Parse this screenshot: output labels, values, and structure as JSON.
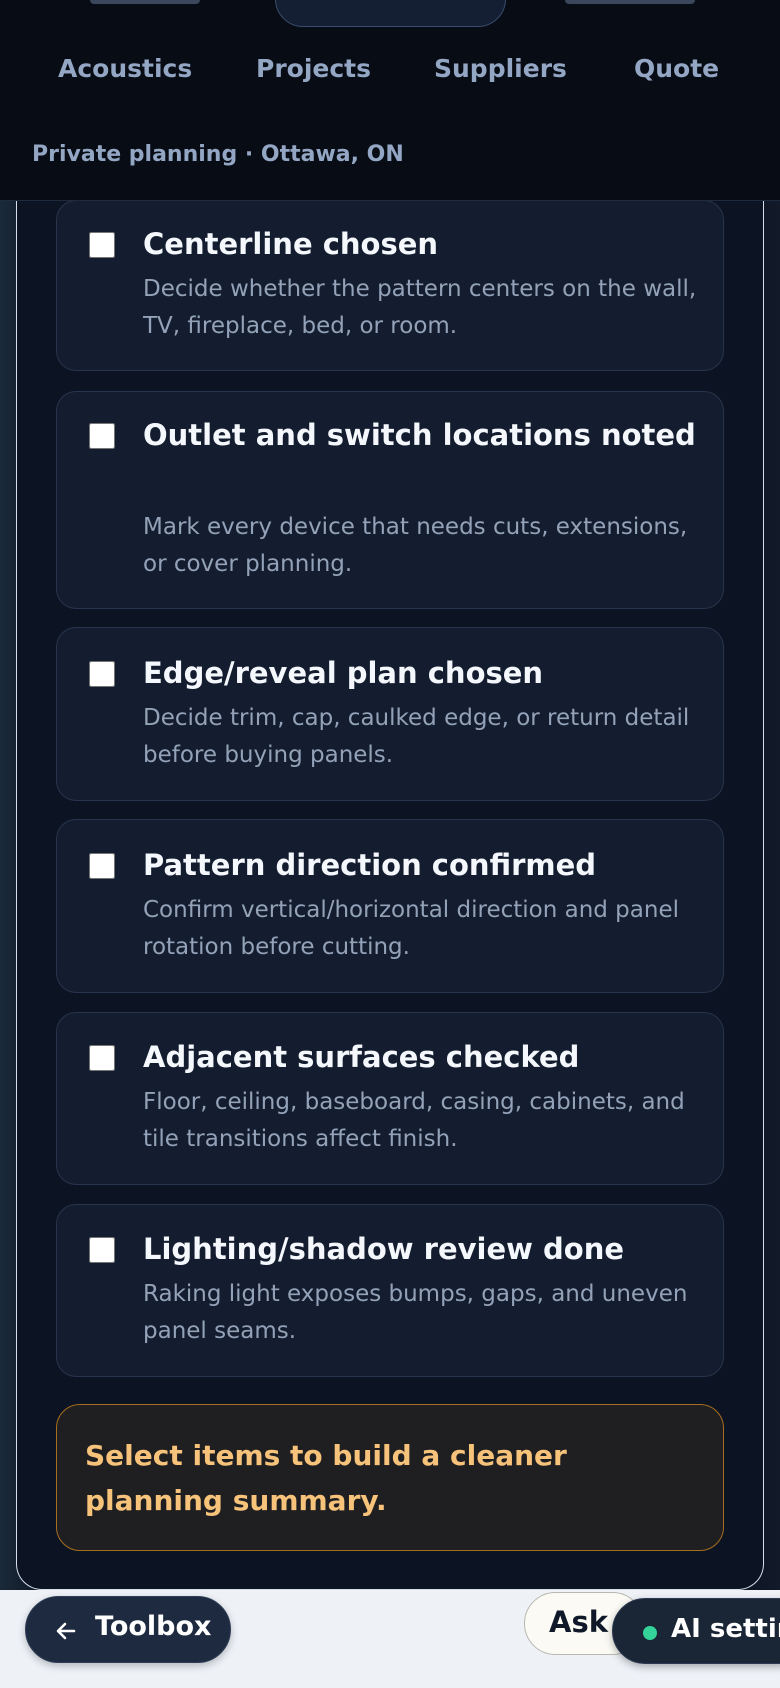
{
  "header": {
    "nav": [
      "Acoustics",
      "Projects",
      "Suppliers",
      "Quote"
    ],
    "context": "Private planning · Ottawa, ON"
  },
  "checklist": [
    {
      "title": "Centerline chosen",
      "desc": "Decide whether the pattern centers on the wall, TV, fireplace, bed, or room.",
      "checked": false
    },
    {
      "title": "Outlet and switch locations noted",
      "desc": "Mark every device that needs cuts, extensions, or cover planning.",
      "checked": false
    },
    {
      "title": "Edge/reveal plan chosen",
      "desc": "Decide trim, cap, caulked edge, or return detail before buying panels.",
      "checked": false
    },
    {
      "title": "Pattern direction confirmed",
      "desc": "Confirm vertical/horizontal direction and panel rotation before cutting.",
      "checked": false
    },
    {
      "title": "Adjacent surfaces checked",
      "desc": "Floor, ceiling, baseboard, casing, cabinets, and tile transitions affect finish.",
      "checked": false
    },
    {
      "title": "Lighting/shadow review done",
      "desc": "Raking light exposes bumps, gaps, and uneven panel seams.",
      "checked": false
    }
  ],
  "summary": "Select items to build a cleaner planning summary.",
  "bottom": {
    "toolbox_label": "Toolbox",
    "ask_label": "Ask",
    "ai_label": "AI settings",
    "ai_status_color": "#34d399"
  },
  "colors": {
    "accent_warning": "#f7c27a",
    "panel_bg": "#0c1424",
    "card_bg": "#141d2f"
  }
}
